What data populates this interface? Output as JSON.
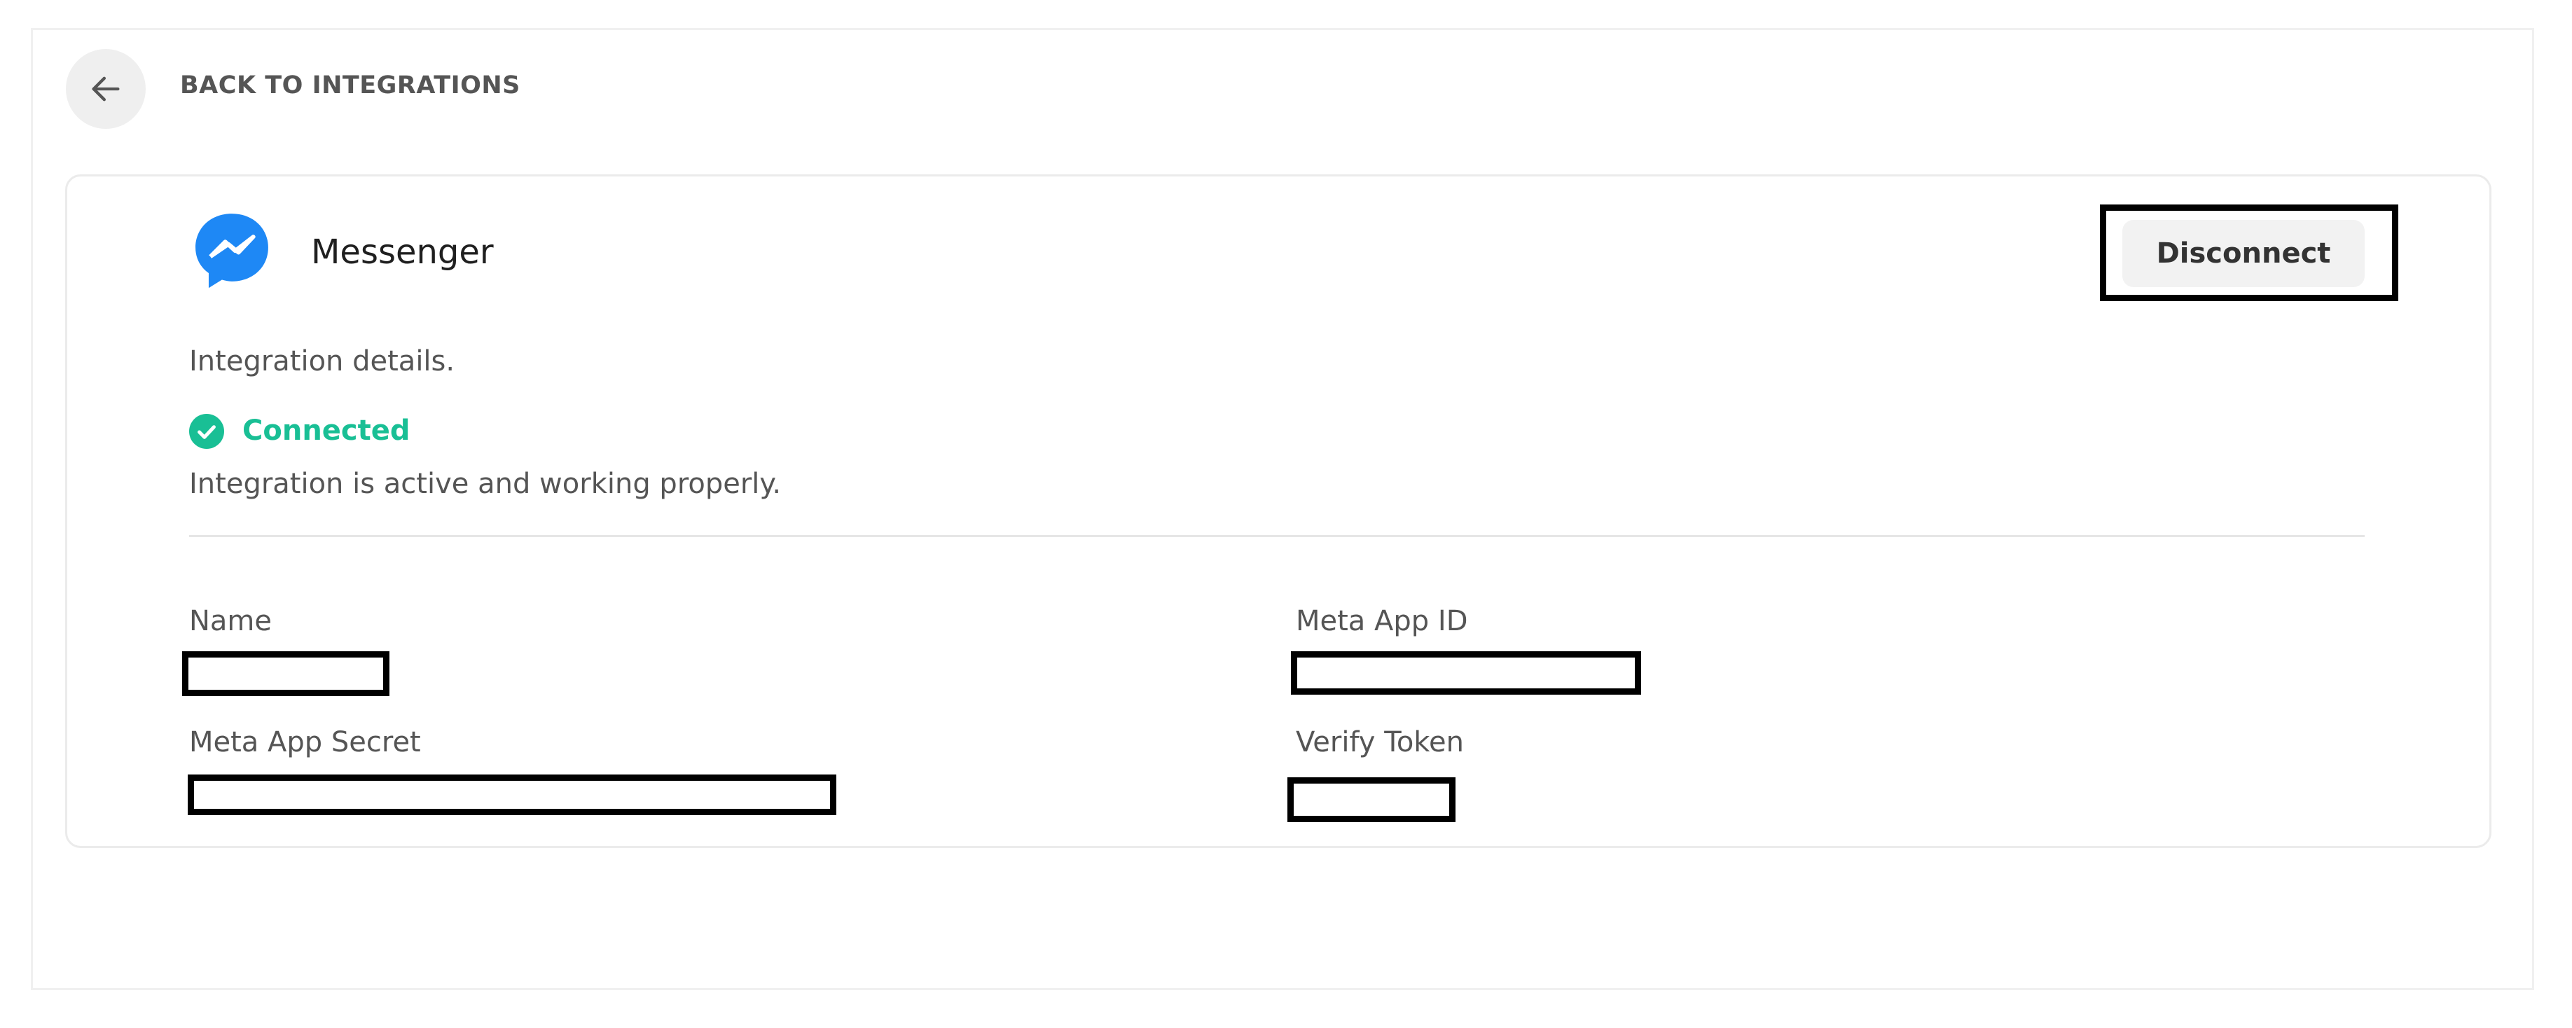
{
  "nav": {
    "back_label": "BACK TO INTEGRATIONS"
  },
  "integration": {
    "name": "Messenger",
    "logo_icon": "messenger-logo-icon",
    "disconnect_label": "Disconnect",
    "details_heading": "Integration details.",
    "status": {
      "label": "Connected",
      "description": "Integration is active and working properly.",
      "color": "#19bf95"
    },
    "fields": {
      "name_label": "Name",
      "meta_app_id_label": "Meta App ID",
      "meta_app_secret_label": "Meta App Secret",
      "verify_token_label": "Verify Token"
    }
  },
  "colors": {
    "messenger_blue": "#1e88f5",
    "status_green": "#19bf95",
    "button_bg": "#f2f2f2"
  }
}
